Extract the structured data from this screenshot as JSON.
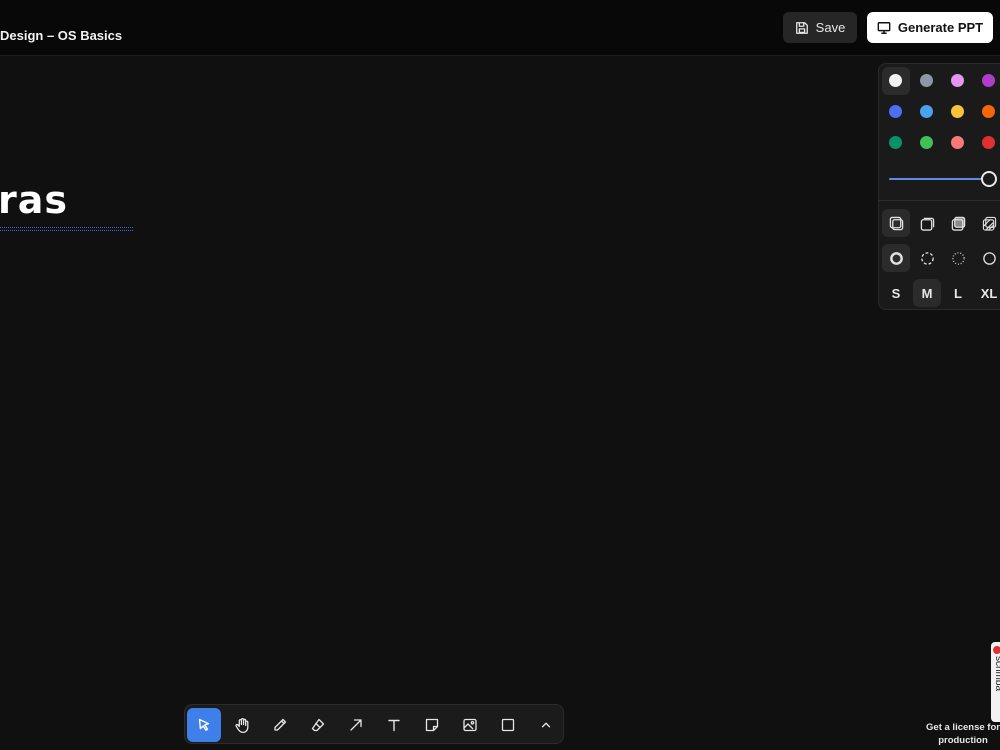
{
  "header": {
    "doc_title": "Design – OS Basics",
    "save_label": "Save",
    "generate_label": "Generate PPT"
  },
  "canvas": {
    "text": "ras"
  },
  "style_panel": {
    "colors": [
      {
        "name": "white",
        "hex": "#f2f2f2",
        "selected": true
      },
      {
        "name": "grey",
        "hex": "#9096a8"
      },
      {
        "name": "light-violet",
        "hex": "#e594ef"
      },
      {
        "name": "violet",
        "hex": "#ae3ec9"
      },
      {
        "name": "blue",
        "hex": "#4b6ff2"
      },
      {
        "name": "light-blue",
        "hex": "#4ba1f1"
      },
      {
        "name": "yellow",
        "hex": "#f8c33a"
      },
      {
        "name": "orange",
        "hex": "#f76707"
      },
      {
        "name": "green",
        "hex": "#099268"
      },
      {
        "name": "light-green",
        "hex": "#40c057"
      },
      {
        "name": "light-red",
        "hex": "#f87777"
      },
      {
        "name": "red",
        "hex": "#e03131"
      }
    ],
    "opacity_value": 1.0,
    "fill_icons": [
      "fill-none-icon",
      "fill-semi-icon",
      "fill-solid-icon",
      "fill-pattern-icon"
    ],
    "dash_icons": [
      "dash-draw-icon",
      "dash-dashed-icon",
      "dash-dotted-icon",
      "dash-solid-icon"
    ],
    "sizes": [
      "S",
      "M",
      "L",
      "XL"
    ],
    "selected_size": "M"
  },
  "toolbar": {
    "tools": [
      "select-icon",
      "hand-icon",
      "draw-icon",
      "eraser-icon",
      "arrow-icon",
      "text-icon",
      "note-icon",
      "asset-icon",
      "rectangle-icon",
      "chevron-up-icon"
    ],
    "active_tool": "select-icon"
  },
  "watermark": {
    "brand": "scrimba",
    "license_text": "Get a license for production"
  },
  "accent": "#3f7fea"
}
